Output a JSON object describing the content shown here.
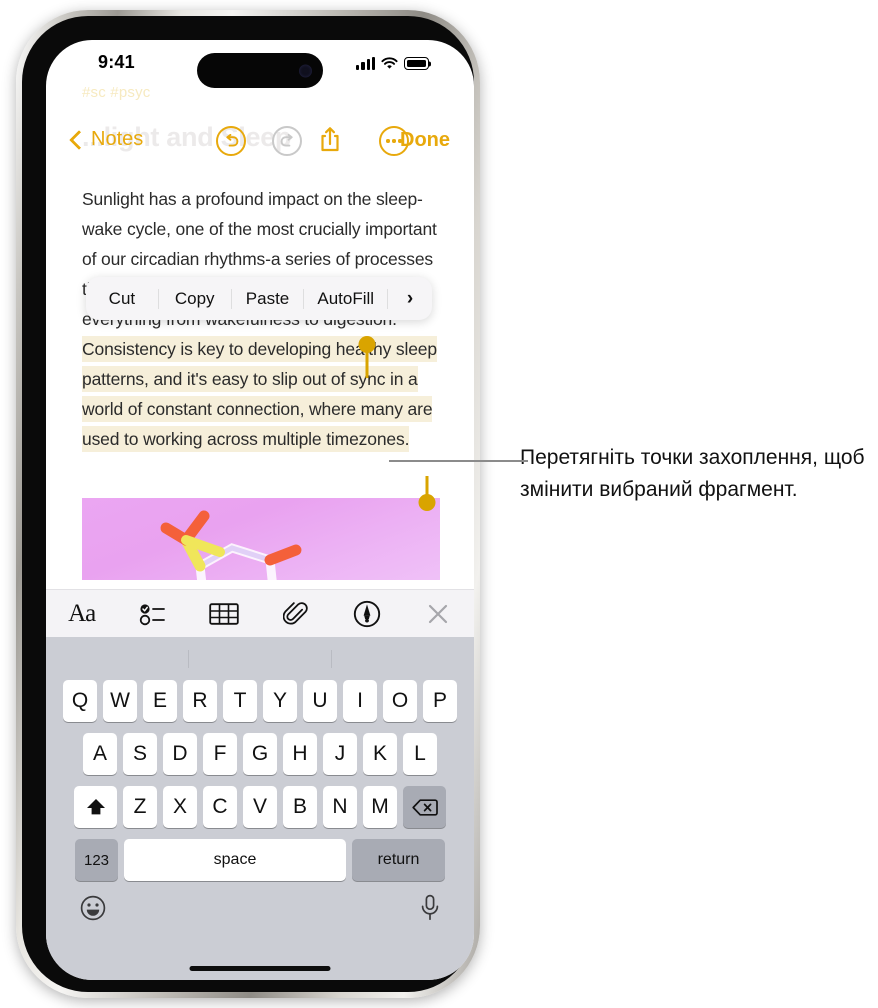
{
  "status_bar": {
    "time": "9:41",
    "icons": [
      "cellular-signal-icon",
      "wifi-icon",
      "battery-icon"
    ]
  },
  "background_text": {
    "tags": "#sc  #psyc",
    "title": "...light and Sleep"
  },
  "nav_bar": {
    "back_label": "Notes",
    "back_icon": "chevron-left-icon",
    "undo_icon": "undo-arrow-icon",
    "redo_icon": "redo-arrow-icon",
    "share_icon": "share-up-arrow-icon",
    "more_icon": "ellipsis-circle-icon",
    "done_label": "Done"
  },
  "note": {
    "before_selection": "Sunlight has a profound impact on the sleep-wake cycle, one of the most crucially important of our circadian rhythms-a series of processes that regulate our bodies' functions to optimize everything from wakefulness to digestion. ",
    "selected_text": "Consistency is key to developing healthy sleep patterns, and it's easy to slip out of sync in a world of constant connection, where many are used to working across multiple timezones.",
    "highlight_color": "#F6EFDA",
    "handle_color": "#D9A400",
    "attachment": "melatonin-molecule-image"
  },
  "context_menu": {
    "items": [
      {
        "label": "Cut"
      },
      {
        "label": "Copy"
      },
      {
        "label": "Paste"
      },
      {
        "label": "AutoFill"
      },
      {
        "label": "›"
      }
    ]
  },
  "format_toolbar": {
    "items": [
      {
        "name": "text-format-button",
        "label": "Aa"
      },
      {
        "name": "checklist-button",
        "label": ""
      },
      {
        "name": "table-button",
        "label": ""
      },
      {
        "name": "attachment-button",
        "label": ""
      },
      {
        "name": "markup-button",
        "label": ""
      },
      {
        "name": "close-button",
        "label": ""
      }
    ]
  },
  "keyboard": {
    "row1": [
      "Q",
      "W",
      "E",
      "R",
      "T",
      "Y",
      "U",
      "I",
      "O",
      "P"
    ],
    "row2": [
      "A",
      "S",
      "D",
      "F",
      "G",
      "H",
      "J",
      "K",
      "L"
    ],
    "row3": [
      "Z",
      "X",
      "C",
      "V",
      "B",
      "N",
      "M"
    ],
    "shift_icon": "shift-arrow-icon",
    "backspace_icon": "backspace-icon",
    "numbers_label": "123",
    "space_label": "space",
    "return_label": "return",
    "emoji_icon": "emoji-smiley-icon",
    "dictation_icon": "microphone-icon"
  },
  "callout": {
    "text": "Перетягніть точки захоплення, щоб змінити вибраний фрагмент."
  },
  "colors": {
    "accent": "#E8A90C",
    "handle": "#D9A400",
    "highlight": "#F6EFDA",
    "keyboard_bg": "#CBCDD4"
  }
}
